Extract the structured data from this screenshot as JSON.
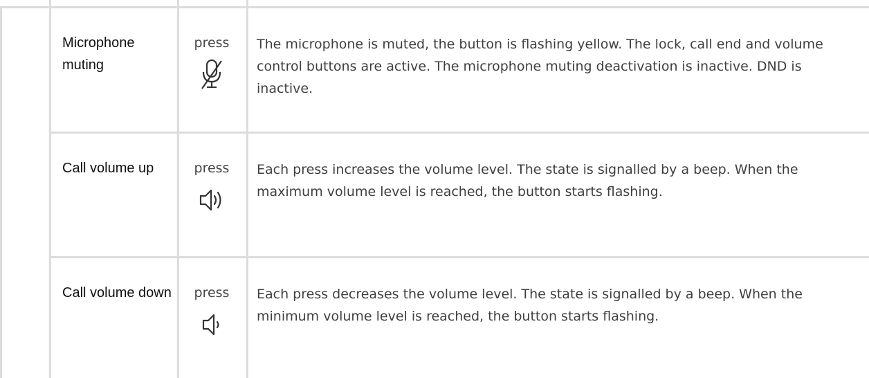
{
  "rows": [
    {
      "name": "Microphone muting",
      "action": "press",
      "icon": "microphone-muted-icon",
      "description": "The microphone is muted, the button is flashing yellow. The lock, call end and volume control buttons are active. The microphone muting deactivation is inactive. DND is inactive."
    },
    {
      "name": "Call volume up",
      "action": "press",
      "icon": "volume-up-icon",
      "description": "Each press increases the volume level. The state is signalled by a beep. When the maximum volume level is reached, the button starts flashing."
    },
    {
      "name": "Call volume down",
      "action": "press",
      "icon": "volume-down-icon",
      "description": "Each press decreases the volume level. The state is signalled by a beep. When the minimum volume level is reached, the button starts flashing."
    }
  ]
}
